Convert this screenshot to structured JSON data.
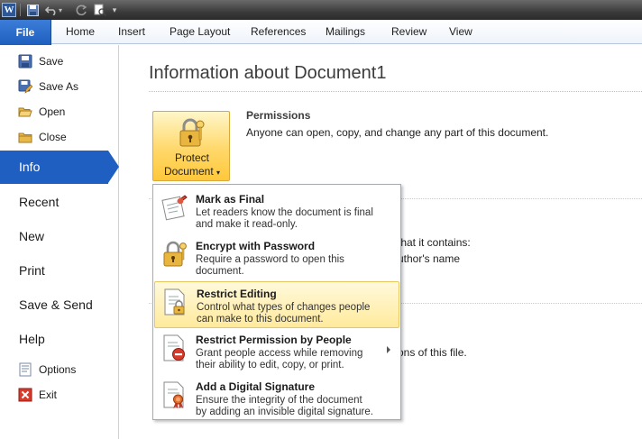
{
  "qat": {
    "logo": "W",
    "icons": [
      "save-icon",
      "undo-icon",
      "redo-icon",
      "print-preview-icon",
      "customize-qat-icon"
    ]
  },
  "ribbon": {
    "file_tab": "File",
    "tabs": [
      "Home",
      "Insert",
      "Page Layout",
      "References",
      "Mailings",
      "Review",
      "View"
    ]
  },
  "nav": {
    "save": "Save",
    "save_as": "Save As",
    "open": "Open",
    "close": "Close",
    "info": "Info",
    "recent": "Recent",
    "new": "New",
    "print": "Print",
    "save_send": "Save & Send",
    "help": "Help",
    "options": "Options",
    "exit": "Exit"
  },
  "main": {
    "title": "Information about Document1",
    "protect_button": {
      "line1": "Protect",
      "line2": "Document"
    },
    "permissions": {
      "title": "Permissions",
      "description": "Anyone can open, copy, and change any part of this document."
    },
    "obscured": {
      "text1": "that it contains:",
      "text2": "uthor's name",
      "text3": "ons of this file."
    }
  },
  "menu": {
    "items": [
      {
        "title": "Mark as Final",
        "line1": "Let readers know the document is final",
        "line2": "and make it read-only."
      },
      {
        "title": "Encrypt with Password",
        "line1": "Require a password to open this",
        "line2": "document."
      },
      {
        "title": "Restrict Editing",
        "line1": "Control what types of changes people",
        "line2": "can make to this document."
      },
      {
        "title": "Restrict Permission by People",
        "line1": "Grant people access while removing",
        "line2": "their ability to edit, copy, or print."
      },
      {
        "title": "Add a Digital Signature",
        "line1": "Ensure the integrity of the document",
        "line2": "by adding an invisible digital signature."
      }
    ]
  },
  "colors": {
    "accent": "#1e5fc1",
    "highlight": "#ffea9c"
  }
}
